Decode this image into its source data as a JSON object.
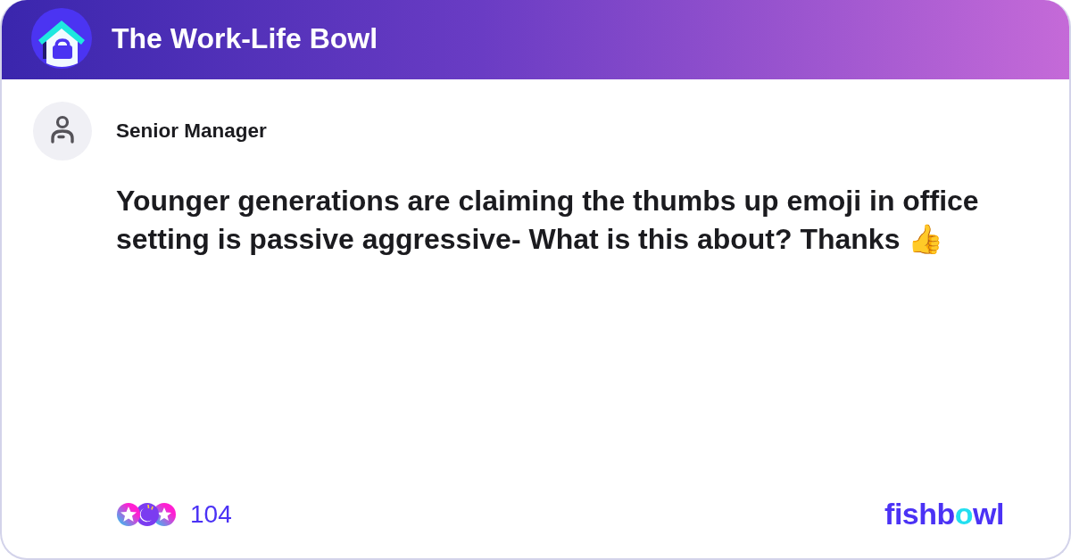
{
  "header": {
    "title": "The Work-Life Bowl"
  },
  "post": {
    "author": "Senior Manager",
    "question": "Younger generations are claiming the thumbs up emoji in office setting is passive aggressive- What is this about? Thanks 👍"
  },
  "footer": {
    "reaction_count": "104",
    "brand": [
      {
        "text": "fishb",
        "accent": false
      },
      {
        "text": "o",
        "accent": true
      },
      {
        "text": "wl",
        "accent": false
      }
    ]
  }
}
